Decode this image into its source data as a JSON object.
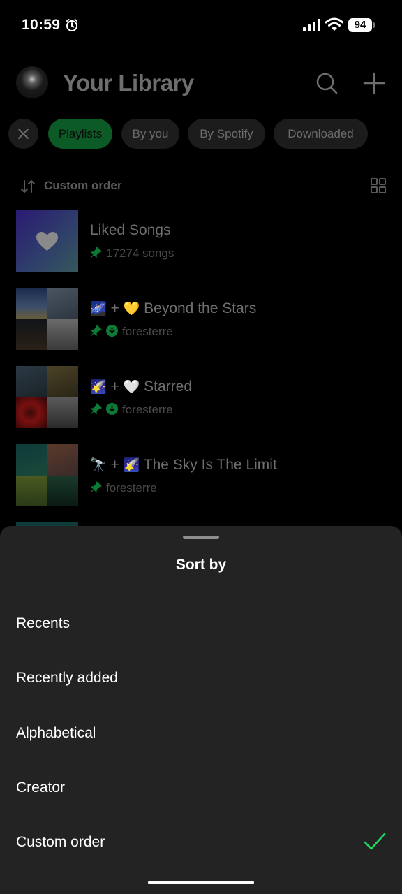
{
  "status_bar": {
    "time": "10:59",
    "battery": "94",
    "icons": [
      "alarm-icon",
      "cellular-signal-icon",
      "wifi-icon",
      "battery-icon"
    ]
  },
  "header": {
    "title": "Your Library",
    "icons": [
      "search-icon",
      "plus-icon"
    ]
  },
  "filters": {
    "chips": [
      "Playlists",
      "By you",
      "By Spotify",
      "Downloaded"
    ],
    "active": "Playlists"
  },
  "sort_row": {
    "label": "Custom order",
    "icons": [
      "sort-arrows-icon",
      "grid-view-icon"
    ]
  },
  "library_items": [
    {
      "title": "Liked Songs",
      "subtitle": "17274 songs",
      "pinned": true,
      "downloaded": false
    },
    {
      "emoji_a": "🌌",
      "emoji_b": "💛",
      "title": "Beyond the Stars",
      "subtitle": "foresterre",
      "pinned": true,
      "downloaded": true
    },
    {
      "emoji_a": "🌠",
      "emoji_b": "🤍",
      "title": "Starred",
      "subtitle": "foresterre",
      "pinned": true,
      "downloaded": true
    },
    {
      "emoji_a": "🔭",
      "emoji_b": "🌠",
      "title": "The Sky Is The Limit",
      "subtitle": "foresterre",
      "pinned": true,
      "downloaded": false
    }
  ],
  "plus_sign": "+",
  "sort_sheet": {
    "title": "Sort by",
    "options": [
      "Recents",
      "Recently added",
      "Alphabetical",
      "Creator",
      "Custom order"
    ],
    "selected": "Custom order"
  },
  "colors": {
    "accent_green": "#1ed760",
    "sheet_bg": "#232323"
  }
}
